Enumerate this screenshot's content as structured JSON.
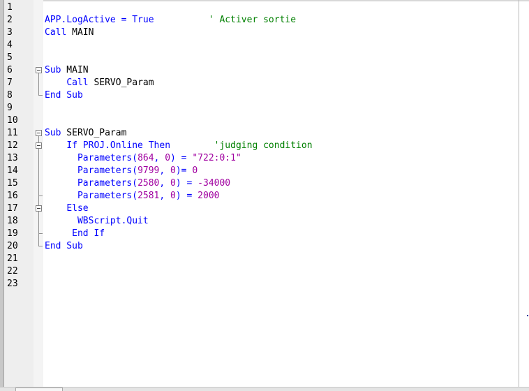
{
  "editor": {
    "colors": {
      "keyword": "#0000ff",
      "number": "#a000a0",
      "string": "#a000a0",
      "comment": "#008000",
      "text": "#000000"
    },
    "lines": [
      {
        "n": "1",
        "tokens": []
      },
      {
        "n": "2",
        "tokens": [
          {
            "t": "kw",
            "v": "APP.LogActive = True"
          },
          {
            "t": "tx",
            "v": "          "
          },
          {
            "t": "cm",
            "v": "' Activer sortie"
          }
        ]
      },
      {
        "n": "3",
        "tokens": [
          {
            "t": "kw",
            "v": "Call"
          },
          {
            "t": "tx",
            "v": " MAIN"
          }
        ]
      },
      {
        "n": "4",
        "tokens": []
      },
      {
        "n": "5",
        "tokens": []
      },
      {
        "n": "6",
        "tokens": [
          {
            "t": "kw",
            "v": "Sub"
          },
          {
            "t": "tx",
            "v": " MAIN"
          }
        ]
      },
      {
        "n": "7",
        "tokens": [
          {
            "t": "tx",
            "v": "    "
          },
          {
            "t": "kw",
            "v": "Call"
          },
          {
            "t": "tx",
            "v": " SERVO_Param"
          }
        ]
      },
      {
        "n": "8",
        "tokens": [
          {
            "t": "kw",
            "v": "End Sub"
          }
        ]
      },
      {
        "n": "9",
        "tokens": []
      },
      {
        "n": "10",
        "tokens": []
      },
      {
        "n": "11",
        "tokens": [
          {
            "t": "kw",
            "v": "Sub"
          },
          {
            "t": "tx",
            "v": " SERVO_Param"
          }
        ]
      },
      {
        "n": "12",
        "tokens": [
          {
            "t": "tx",
            "v": "    "
          },
          {
            "t": "kw",
            "v": "If PROJ.Online Then"
          },
          {
            "t": "tx",
            "v": "        "
          },
          {
            "t": "cm",
            "v": "'judging condition"
          }
        ]
      },
      {
        "n": "13",
        "tokens": [
          {
            "t": "tx",
            "v": "      "
          },
          {
            "t": "kw",
            "v": "Parameters("
          },
          {
            "t": "nm",
            "v": "864"
          },
          {
            "t": "kw",
            "v": ", "
          },
          {
            "t": "nm",
            "v": "0"
          },
          {
            "t": "kw",
            "v": ") = "
          },
          {
            "t": "str",
            "v": "\"722:0:1\""
          }
        ]
      },
      {
        "n": "14",
        "tokens": [
          {
            "t": "tx",
            "v": "      "
          },
          {
            "t": "kw",
            "v": "Parameters("
          },
          {
            "t": "nm",
            "v": "9799"
          },
          {
            "t": "kw",
            "v": ", "
          },
          {
            "t": "nm",
            "v": "0"
          },
          {
            "t": "kw",
            "v": ")= "
          },
          {
            "t": "nm",
            "v": "0"
          }
        ]
      },
      {
        "n": "15",
        "tokens": [
          {
            "t": "tx",
            "v": "      "
          },
          {
            "t": "kw",
            "v": "Parameters("
          },
          {
            "t": "nm",
            "v": "2580"
          },
          {
            "t": "kw",
            "v": ", "
          },
          {
            "t": "nm",
            "v": "0"
          },
          {
            "t": "kw",
            "v": ") = "
          },
          {
            "t": "nm",
            "v": "-34000"
          }
        ]
      },
      {
        "n": "16",
        "tokens": [
          {
            "t": "tx",
            "v": "      "
          },
          {
            "t": "kw",
            "v": "Parameters("
          },
          {
            "t": "nm",
            "v": "2581"
          },
          {
            "t": "kw",
            "v": ", "
          },
          {
            "t": "nm",
            "v": "0"
          },
          {
            "t": "kw",
            "v": ") = "
          },
          {
            "t": "nm",
            "v": "2000"
          }
        ]
      },
      {
        "n": "17",
        "tokens": [
          {
            "t": "tx",
            "v": "    "
          },
          {
            "t": "kw",
            "v": "Else"
          }
        ]
      },
      {
        "n": "18",
        "tokens": [
          {
            "t": "tx",
            "v": "      "
          },
          {
            "t": "kw",
            "v": "WBScript.Quit"
          }
        ]
      },
      {
        "n": "19",
        "tokens": [
          {
            "t": "tx",
            "v": "     "
          },
          {
            "t": "kw",
            "v": "End If"
          }
        ]
      },
      {
        "n": "20",
        "tokens": [
          {
            "t": "kw",
            "v": "End Sub"
          }
        ]
      },
      {
        "n": "21",
        "tokens": []
      },
      {
        "n": "22",
        "tokens": []
      },
      {
        "n": "23",
        "tokens": []
      }
    ]
  }
}
